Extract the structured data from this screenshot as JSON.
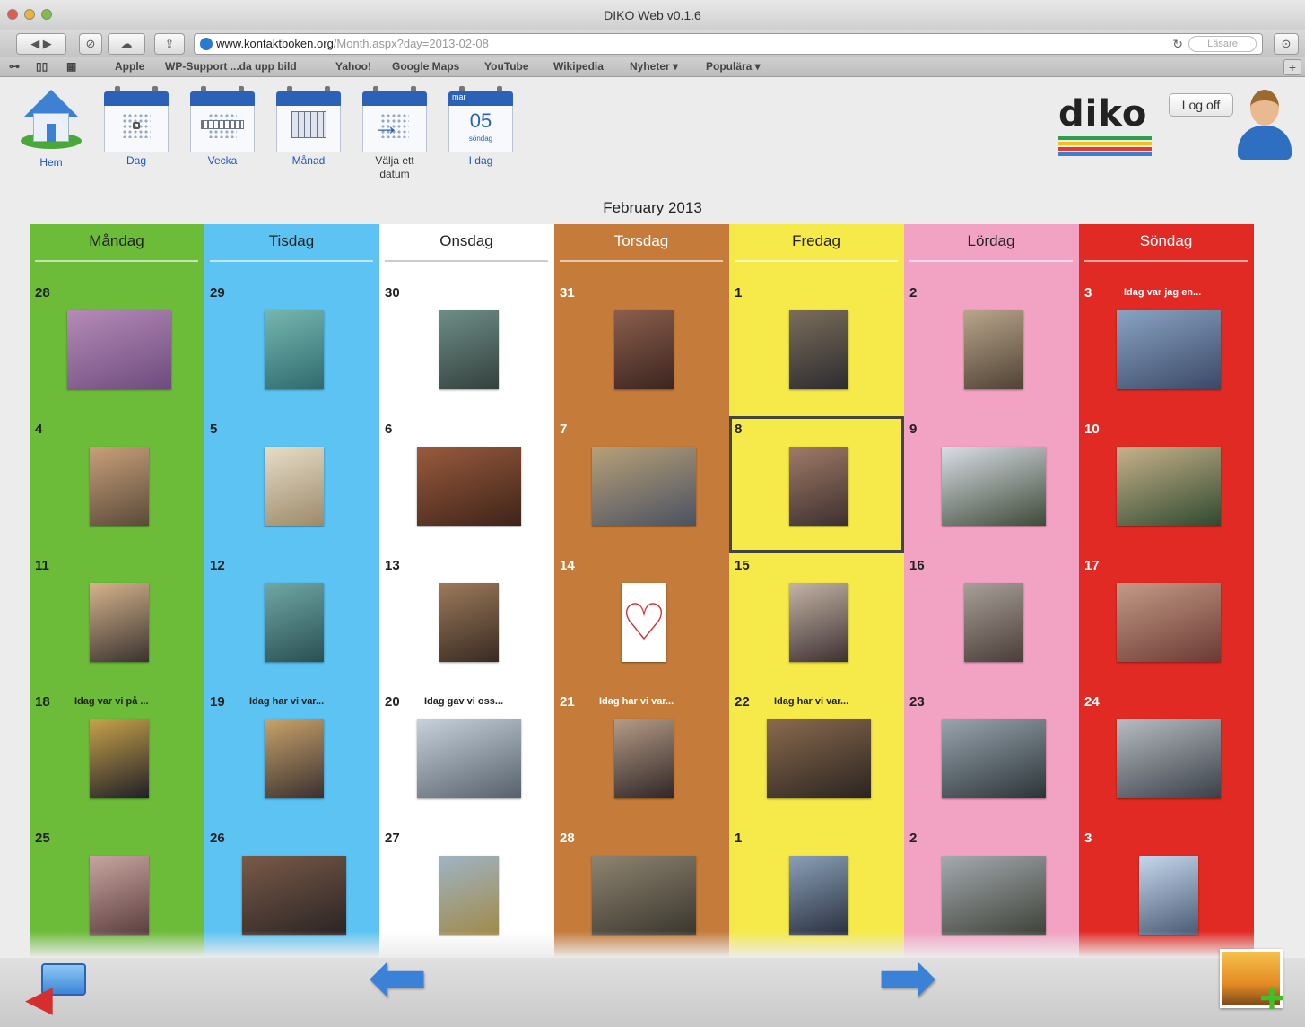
{
  "window": {
    "title": "DIKO Web v0.1.6"
  },
  "browser": {
    "url_host": "www.kontaktboken.org",
    "url_path": "/Month.aspx?day=2013-02-08",
    "reader_label": "Läsare",
    "bookmarks": [
      "Apple",
      "WP-Support ...da upp bild",
      "Yahoo!",
      "Google Maps",
      "YouTube",
      "Wikipedia",
      "Nyheter ▾",
      "Populära ▾"
    ]
  },
  "nav": {
    "home": "Hem",
    "day": "Dag",
    "week": "Vecka",
    "month": "Månad",
    "pick_date": "Välja ett datum",
    "today": "I dag",
    "today_icon": {
      "month": "mar",
      "day": "05",
      "weekday": "söndag"
    }
  },
  "logo_text": "diko",
  "logo_colors": [
    "#2aa24b",
    "#f2c21a",
    "#e23b2e",
    "#3a7fd0"
  ],
  "logoff_label": "Log off",
  "month_title": "February 2013",
  "calendar": {
    "days": [
      "Måndag",
      "Tisdag",
      "Onsdag",
      "Torsdag",
      "Fredag",
      "Lördag",
      "Söndag"
    ],
    "column_colors": [
      "#6cbc3a",
      "#5cc3f3",
      "#ffffff",
      "#c57b3a",
      "#f5ea4a",
      "#f2a2c2",
      "#e12a23"
    ],
    "header_text_colors": [
      "#222222",
      "#222222",
      "#222222",
      "#ffffff",
      "#222222",
      "#222222",
      "#ffffff"
    ],
    "weeks": [
      [
        {
          "day": "28",
          "note": "",
          "photo": "wide",
          "tint": [
            "#b58bb8",
            "#6d4b7d"
          ]
        },
        {
          "day": "29",
          "note": "",
          "photo": "portrait",
          "tint": [
            "#76b7b0",
            "#2f6a6e"
          ]
        },
        {
          "day": "30",
          "note": "",
          "photo": "portrait",
          "tint": [
            "#6e8d86",
            "#33403e"
          ]
        },
        {
          "day": "31",
          "note": "",
          "photo": "portrait",
          "tint": [
            "#8b5e4c",
            "#3b2520"
          ]
        },
        {
          "day": "1",
          "note": "",
          "photo": "portrait",
          "tint": [
            "#7a6d5a",
            "#2d2b30"
          ]
        },
        {
          "day": "2",
          "note": "",
          "photo": "portrait",
          "tint": [
            "#b9a58b",
            "#4f4234"
          ]
        },
        {
          "day": "3",
          "note": "Idag var jag en...",
          "photo": "wide",
          "tint": [
            "#8aa3c3",
            "#3b4866"
          ]
        }
      ],
      [
        {
          "day": "4",
          "note": "",
          "photo": "portrait",
          "tint": [
            "#c9a07a",
            "#5a4a3a"
          ]
        },
        {
          "day": "5",
          "note": "",
          "photo": "portrait",
          "tint": [
            "#e8ddc8",
            "#9c8a6a"
          ]
        },
        {
          "day": "6",
          "note": "",
          "photo": "wide",
          "tint": [
            "#9a5a3e",
            "#3d2418"
          ]
        },
        {
          "day": "7",
          "note": "",
          "photo": "wide",
          "tint": [
            "#b8a078",
            "#4a5262"
          ]
        },
        {
          "day": "8",
          "note": "",
          "photo": "portrait",
          "tint": [
            "#a07a66",
            "#3d3030"
          ],
          "selected": true
        },
        {
          "day": "9",
          "note": "",
          "photo": "wide",
          "tint": [
            "#d9dee6",
            "#3f4a38"
          ]
        },
        {
          "day": "10",
          "note": "",
          "photo": "wide",
          "tint": [
            "#c8b28a",
            "#2f4a30"
          ]
        }
      ],
      [
        {
          "day": "11",
          "note": "",
          "photo": "portrait",
          "tint": [
            "#d6b48b",
            "#3a3230"
          ]
        },
        {
          "day": "12",
          "note": "",
          "photo": "portrait",
          "tint": [
            "#6fa8a4",
            "#2a4f52"
          ]
        },
        {
          "day": "13",
          "note": "",
          "photo": "portrait",
          "tint": [
            "#9c7a5a",
            "#382a22"
          ]
        },
        {
          "day": "14",
          "note": "",
          "photo": "heart",
          "tint": [
            "#ffffff",
            "#ffffff"
          ]
        },
        {
          "day": "15",
          "note": "",
          "photo": "portrait",
          "tint": [
            "#c4b4a4",
            "#3d3034"
          ]
        },
        {
          "day": "16",
          "note": "",
          "photo": "portrait",
          "tint": [
            "#a8a098",
            "#4a3e38"
          ]
        },
        {
          "day": "17",
          "note": "",
          "photo": "wide",
          "tint": [
            "#c49a86",
            "#6a3a34"
          ]
        }
      ],
      [
        {
          "day": "18",
          "note": "Idag var vi på ...",
          "photo": "portrait",
          "tint": [
            "#c7a24a",
            "#1f1f28"
          ]
        },
        {
          "day": "19",
          "note": "Idag har vi var...",
          "photo": "portrait",
          "tint": [
            "#c9a36a",
            "#3a3030"
          ]
        },
        {
          "day": "20",
          "note": "Idag gav vi oss...",
          "photo": "wide",
          "tint": [
            "#c7d1dc",
            "#56606a"
          ]
        },
        {
          "day": "21",
          "note": "Idag har vi var...",
          "photo": "portrait",
          "tint": [
            "#b59b86",
            "#2f2626"
          ]
        },
        {
          "day": "22",
          "note": "Idag har vi var...",
          "photo": "wide",
          "tint": [
            "#8a6a4e",
            "#2a2420"
          ]
        },
        {
          "day": "23",
          "note": "",
          "photo": "wide",
          "tint": [
            "#9aa4ae",
            "#2a3438"
          ]
        },
        {
          "day": "24",
          "note": "",
          "photo": "wide",
          "tint": [
            "#b8bcc2",
            "#3a4048"
          ]
        }
      ],
      [
        {
          "day": "25",
          "note": "",
          "photo": "portrait",
          "tint": [
            "#c9a5a0",
            "#5a3e3e"
          ]
        },
        {
          "day": "26",
          "note": "",
          "photo": "wide",
          "tint": [
            "#7a5a48",
            "#2a2424"
          ]
        },
        {
          "day": "27",
          "note": "",
          "photo": "portrait",
          "tint": [
            "#9fb4c4",
            "#a08a4a"
          ]
        },
        {
          "day": "28",
          "note": "",
          "photo": "wide",
          "tint": [
            "#8e8470",
            "#3a362e"
          ]
        },
        {
          "day": "1",
          "note": "",
          "photo": "portrait",
          "tint": [
            "#8aa0b8",
            "#2a3040"
          ]
        },
        {
          "day": "2",
          "note": "",
          "photo": "wide",
          "tint": [
            "#a4aab0",
            "#3e4238"
          ]
        },
        {
          "day": "3",
          "note": "",
          "photo": "portrait",
          "tint": [
            "#c6d8ee",
            "#4a5a74"
          ]
        }
      ]
    ]
  }
}
